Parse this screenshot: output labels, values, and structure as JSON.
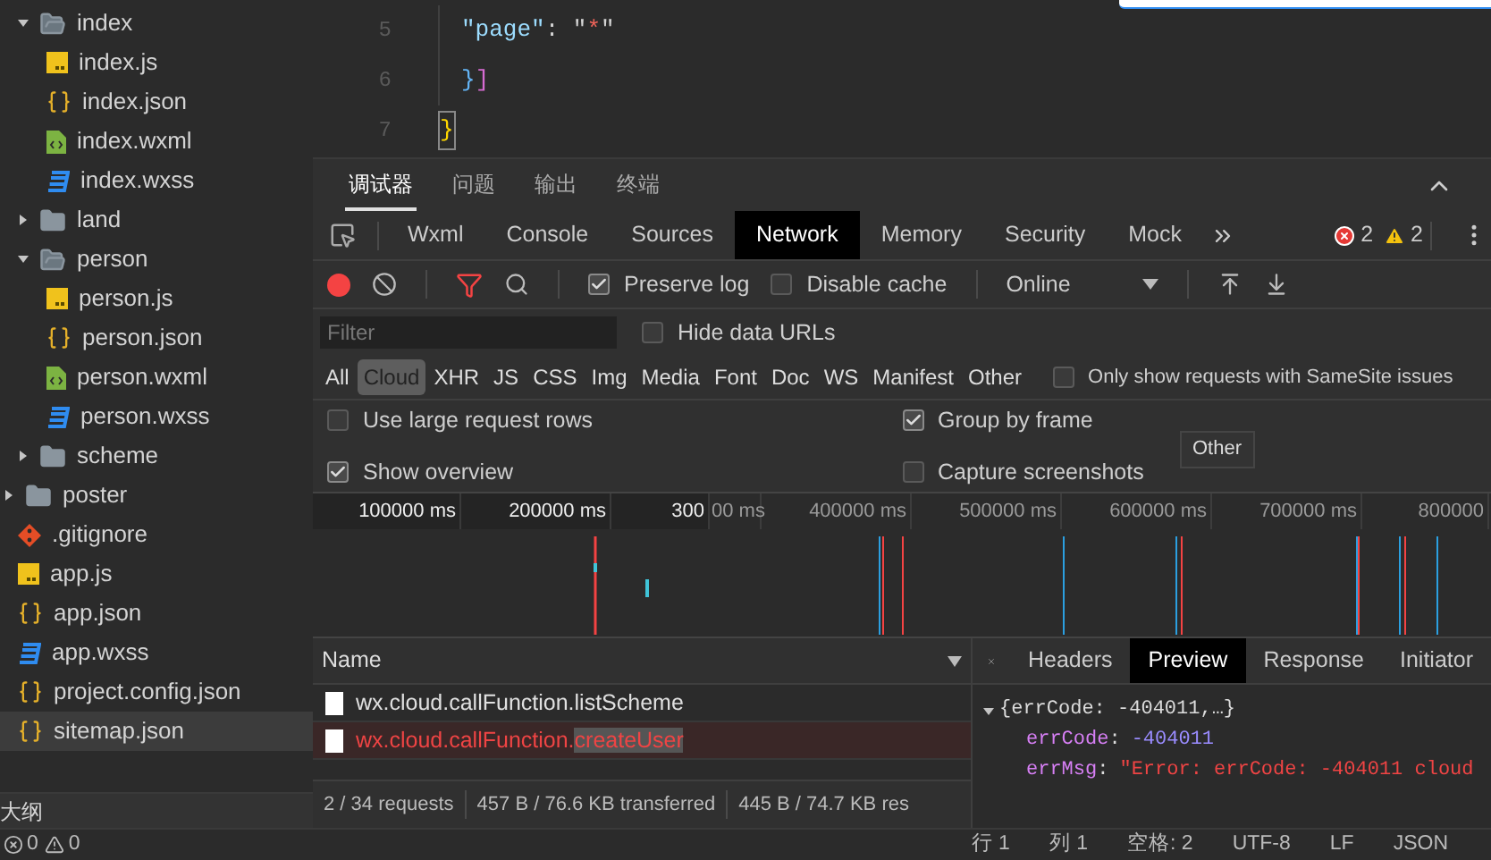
{
  "sidebar": {
    "tree": [
      {
        "kind": "offscreen",
        "children": [
          {
            "kind": "folder",
            "name": "index",
            "expanded": true,
            "selected": false,
            "children": [
              {
                "kind": "js",
                "name": "index.js",
                "selected": false
              },
              {
                "kind": "json",
                "name": "index.json",
                "selected": false
              },
              {
                "kind": "wxml",
                "name": "index.wxml",
                "selected": false
              },
              {
                "kind": "wxss",
                "name": "index.wxss",
                "selected": false
              }
            ]
          },
          {
            "kind": "folder",
            "name": "land",
            "expanded": false,
            "selected": false
          },
          {
            "kind": "folder",
            "name": "person",
            "expanded": true,
            "selected": false,
            "children": [
              {
                "kind": "js",
                "name": "person.js",
                "selected": false
              },
              {
                "kind": "json",
                "name": "person.json",
                "selected": false
              },
              {
                "kind": "wxml",
                "name": "person.wxml",
                "selected": false
              },
              {
                "kind": "wxss",
                "name": "person.wxss",
                "selected": false
              }
            ]
          },
          {
            "kind": "folder",
            "name": "scheme",
            "expanded": false,
            "selected": false
          }
        ]
      },
      {
        "kind": "folder",
        "name": "poster",
        "expanded": false,
        "selected": false
      },
      {
        "kind": "git",
        "name": ".gitignore",
        "selected": false
      },
      {
        "kind": "js",
        "name": "app.js",
        "selected": false
      },
      {
        "kind": "json",
        "name": "app.json",
        "selected": false
      },
      {
        "kind": "wxss",
        "name": "app.wxss",
        "selected": false
      },
      {
        "kind": "json",
        "name": "project.config.json",
        "selected": false
      },
      {
        "kind": "json",
        "name": "sitemap.json",
        "selected": true
      }
    ],
    "outline_title": "大纲"
  },
  "editor": {
    "lines": [
      {
        "number": "5",
        "indented": true,
        "tokens": [
          {
            "text": "\"page\"",
            "kind": "key"
          },
          {
            "text": ": \"",
            "kind": "plain"
          },
          {
            "text": "*",
            "kind": "special"
          },
          {
            "text": "\"",
            "kind": "plain"
          }
        ]
      },
      {
        "number": "6",
        "indented": true,
        "tokens": [
          {
            "text": "}",
            "kind": "brace1"
          },
          {
            "text": "]",
            "kind": "brace2"
          }
        ]
      },
      {
        "number": "7",
        "indented": false,
        "tokens": [
          {
            "text": "}",
            "kind": "matched"
          }
        ]
      }
    ]
  },
  "panel_tabs": [
    {
      "label": "调试器",
      "selected": true
    },
    {
      "label": "问题",
      "selected": false
    },
    {
      "label": "输出",
      "selected": false
    },
    {
      "label": "终端",
      "selected": false
    }
  ],
  "devtools": {
    "tabs": [
      {
        "label": "Wxml",
        "selected": false
      },
      {
        "label": "Console",
        "selected": false
      },
      {
        "label": "Sources",
        "selected": false
      },
      {
        "label": "Network",
        "selected": true
      },
      {
        "label": "Memory",
        "selected": false
      },
      {
        "label": "Security",
        "selected": false
      },
      {
        "label": "Mock",
        "selected": false
      }
    ],
    "error_count": "2",
    "warning_count": "2",
    "toolbar": {
      "recording": true,
      "filter_active": true,
      "preserve_log": {
        "label": "Preserve log",
        "checked": true
      },
      "disable_cache": {
        "label": "Disable cache",
        "checked": false
      },
      "throttling": "Online"
    },
    "filter": {
      "placeholder": "Filter"
    },
    "hide_data_urls": {
      "label": "Hide data URLs",
      "checked": false
    },
    "types": [
      {
        "label": "All",
        "selected": false
      },
      {
        "label": "Cloud",
        "selected": true
      },
      {
        "label": "XHR",
        "selected": false
      },
      {
        "label": "JS",
        "selected": false
      },
      {
        "label": "CSS",
        "selected": false
      },
      {
        "label": "Img",
        "selected": false
      },
      {
        "label": "Media",
        "selected": false
      },
      {
        "label": "Font",
        "selected": false
      },
      {
        "label": "Doc",
        "selected": false
      },
      {
        "label": "WS",
        "selected": false
      },
      {
        "label": "Manifest",
        "selected": false
      },
      {
        "label": "Other",
        "selected": false
      }
    ],
    "samesite": {
      "label": "Only show requests with SameSite issues",
      "checked": false
    },
    "settings": [
      {
        "label": "Use large request rows",
        "checked": false
      },
      {
        "label": "Group by frame",
        "checked": true
      },
      {
        "label": "Show overview",
        "checked": true
      },
      {
        "label": "Capture screenshots",
        "checked": false
      }
    ],
    "tooltip": "Other",
    "timeline": {
      "ticks": [
        {
          "label": "100000 ms",
          "selected": true
        },
        {
          "label": "200000 ms",
          "selected": true
        },
        {
          "label": "300",
          "selected": true
        },
        {
          "label": "00 ms",
          "selected": false
        },
        {
          "label": "400000 ms",
          "selected": false
        },
        {
          "label": "500000 ms",
          "selected": false
        },
        {
          "label": "600000 ms",
          "selected": false
        },
        {
          "label": "700000 ms",
          "selected": false
        },
        {
          "label": "800000",
          "selected": false
        }
      ]
    },
    "requests": {
      "column": "Name",
      "rows": [
        {
          "name": "wx.cloud.callFunction.listScheme",
          "error": false
        },
        {
          "name": "wx.cloud.callFunction.",
          "match": "createUser",
          "error": true
        }
      ],
      "summary": [
        "2 / 34 requests",
        "457 B / 76.6 KB transferred",
        "445 B / 74.7 KB res"
      ]
    },
    "details": {
      "tabs": [
        {
          "label": "Headers",
          "selected": false
        },
        {
          "label": "Preview",
          "selected": true
        },
        {
          "label": "Response",
          "selected": false
        },
        {
          "label": "Initiator",
          "selected": false
        }
      ],
      "preview": {
        "summary": "{errCode: -404011,…}",
        "expanded": true,
        "fields": [
          {
            "key": "errCode",
            "separator": ":",
            "value": "-404011",
            "kind": "number"
          },
          {
            "key": "errMsg",
            "separator": ":",
            "value": "\"Error: errCode: -404011 cloud",
            "kind": "string"
          }
        ]
      }
    }
  },
  "status_bar": {
    "errors": "0",
    "warnings": "0",
    "items": [
      "行 1",
      "列 1",
      "空格: 2",
      "UTF-8",
      "LF",
      "JSON"
    ]
  }
}
